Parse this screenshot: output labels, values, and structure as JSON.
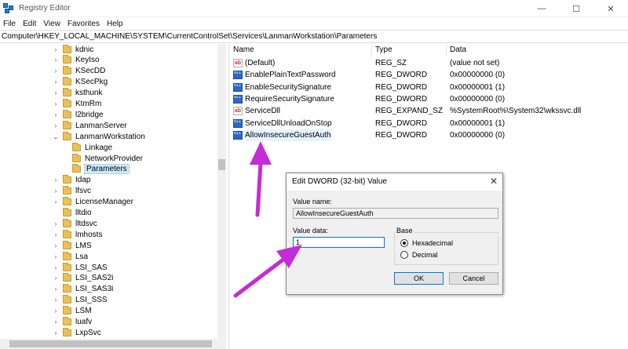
{
  "window": {
    "title": "Registry Editor",
    "controls": {
      "minimize": "—",
      "maximize": "☐",
      "close": "✕"
    }
  },
  "menu": [
    "File",
    "Edit",
    "View",
    "Favorites",
    "Help"
  ],
  "address": "Computer\\HKEY_LOCAL_MACHINE\\SYSTEM\\CurrentControlSet\\Services\\LanmanWorkstation\\Parameters",
  "tree": [
    {
      "label": "kdnic",
      "expander": "›",
      "depth": 0
    },
    {
      "label": "KeyIso",
      "expander": "›",
      "depth": 0
    },
    {
      "label": "KSecDD",
      "expander": "›",
      "depth": 0
    },
    {
      "label": "KSecPkg",
      "expander": "›",
      "depth": 0
    },
    {
      "label": "ksthunk",
      "expander": "›",
      "depth": 0
    },
    {
      "label": "KtmRm",
      "expander": "›",
      "depth": 0
    },
    {
      "label": "l2bridge",
      "expander": "›",
      "depth": 0
    },
    {
      "label": "LanmanServer",
      "expander": "›",
      "depth": 0
    },
    {
      "label": "LanmanWorkstation",
      "expander": "⌄",
      "depth": 0
    },
    {
      "label": "Linkage",
      "expander": "",
      "depth": 1
    },
    {
      "label": "NetworkProvider",
      "expander": "",
      "depth": 1
    },
    {
      "label": "Parameters",
      "expander": "",
      "depth": 1,
      "selected": true
    },
    {
      "label": "Idap",
      "expander": "›",
      "depth": 0
    },
    {
      "label": "lfsvc",
      "expander": "›",
      "depth": 0
    },
    {
      "label": "LicenseManager",
      "expander": "›",
      "depth": 0
    },
    {
      "label": "lltdio",
      "expander": "",
      "depth": 0
    },
    {
      "label": "lltdsvc",
      "expander": "›",
      "depth": 0
    },
    {
      "label": "lmhosts",
      "expander": "›",
      "depth": 0
    },
    {
      "label": "LMS",
      "expander": "›",
      "depth": 0
    },
    {
      "label": "Lsa",
      "expander": "›",
      "depth": 0
    },
    {
      "label": "LSI_SAS",
      "expander": "›",
      "depth": 0
    },
    {
      "label": "LSI_SAS2i",
      "expander": "›",
      "depth": 0
    },
    {
      "label": "LSI_SAS3i",
      "expander": "›",
      "depth": 0
    },
    {
      "label": "LSI_SSS",
      "expander": "›",
      "depth": 0
    },
    {
      "label": "LSM",
      "expander": "›",
      "depth": 0
    },
    {
      "label": "luafv",
      "expander": "›",
      "depth": 0
    },
    {
      "label": "LxpSvc",
      "expander": "›",
      "depth": 0
    }
  ],
  "list": {
    "columns": [
      "Name",
      "Type",
      "Data"
    ],
    "rows": [
      {
        "icon": "string",
        "name": "(Default)",
        "type": "REG_SZ",
        "data": "(value not set)"
      },
      {
        "icon": "binary",
        "name": "EnablePlainTextPassword",
        "type": "REG_DWORD",
        "data": "0x00000000 (0)"
      },
      {
        "icon": "binary",
        "name": "EnableSecuritySignature",
        "type": "REG_DWORD",
        "data": "0x00000001 (1)"
      },
      {
        "icon": "binary",
        "name": "RequireSecuritySignature",
        "type": "REG_DWORD",
        "data": "0x00000000 (0)"
      },
      {
        "icon": "string",
        "name": "ServiceDll",
        "type": "REG_EXPAND_SZ",
        "data": "%SystemRoot%\\System32\\wkssvc.dll"
      },
      {
        "icon": "binary",
        "name": "ServiceDllUnloadOnStop",
        "type": "REG_DWORD",
        "data": "0x00000001 (1)"
      },
      {
        "icon": "binary",
        "name": "AllowInsecureGuestAuth",
        "type": "REG_DWORD",
        "data": "0x00000000 (0)",
        "selected": true
      }
    ]
  },
  "dialog": {
    "title": "Edit DWORD (32-bit) Value",
    "close": "✕",
    "value_name_label": "Value name:",
    "value_name": "AllowInsecureGuestAuth",
    "value_data_label": "Value data:",
    "value_data": "1",
    "base_label": "Base",
    "hex_label": "Hexadecimal",
    "dec_label": "Decimal",
    "base_selected": "Hexadecimal",
    "ok": "OK",
    "cancel": "Cancel"
  },
  "colors": {
    "annotation_arrow": "#c62bd8",
    "selection": "#cce8ff",
    "folder": "#e8c15a",
    "focus_border": "#0078d7"
  },
  "icons": [
    "registry-editor-icon",
    "folder-icon",
    "string-value-icon",
    "binary-value-icon",
    "radio-icon"
  ]
}
